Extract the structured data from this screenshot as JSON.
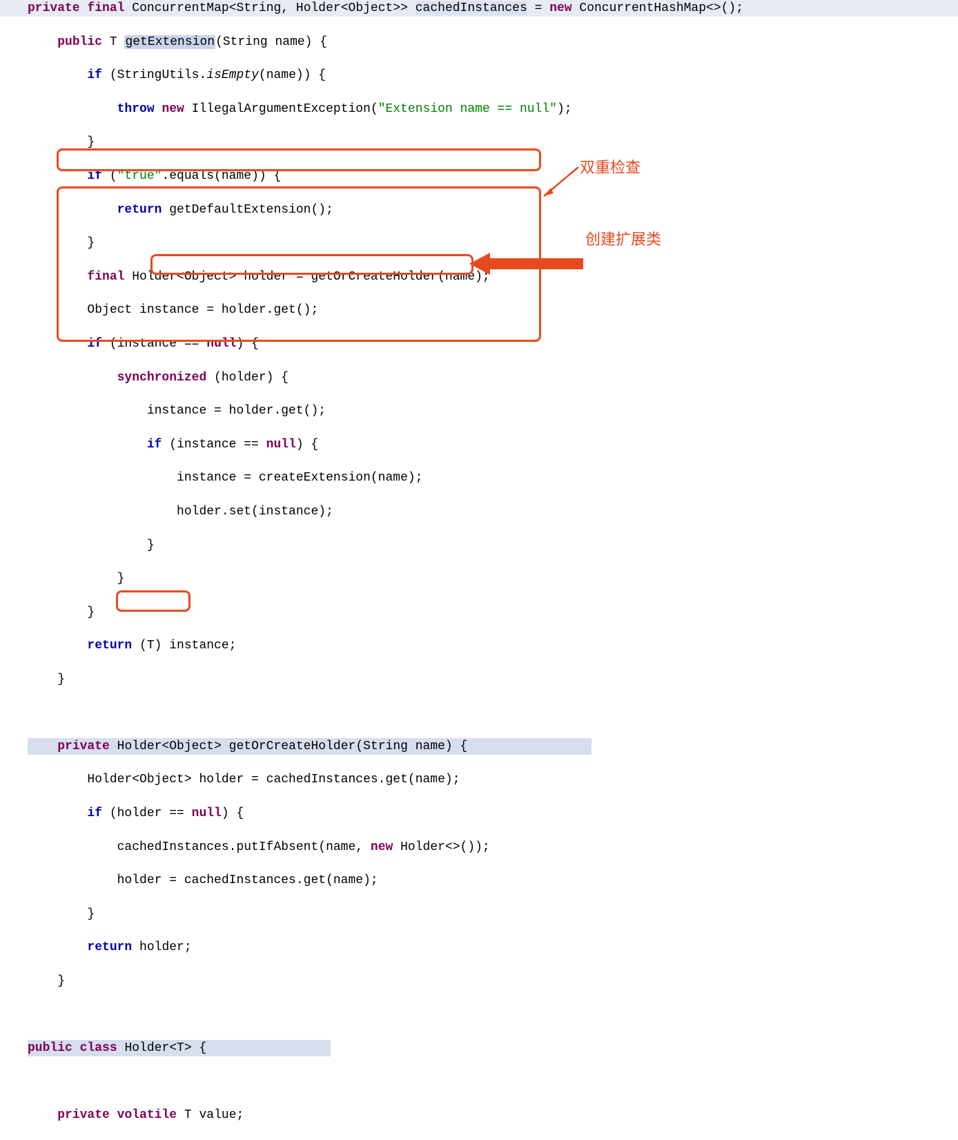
{
  "code": {
    "l1": {
      "private": "private",
      "final": "final",
      "type": "ConcurrentMap<String, Holder<Object>>",
      "var": "cachedInstances",
      "eq": " = ",
      "new": "new",
      "ctor": " ConcurrentHashMap<>();"
    },
    "l2": {
      "public": "public",
      "t": " T ",
      "method": "getExtension",
      "sig": "(String name) {"
    },
    "l3": {
      "if": "if",
      "a": " (StringUtils.",
      "isEmpty": "isEmpty",
      "b": "(name)) {"
    },
    "l4": {
      "throw": "throw",
      "sp": " ",
      "new": "new",
      "a": " IllegalArgumentException(",
      "s": "\"Extension name == null\"",
      "b": ");"
    },
    "l5": "        }",
    "l6": {
      "if": "if",
      "a": " (",
      "s": "\"true\"",
      "b": ".equals(name)) {"
    },
    "l7": {
      "return": "return",
      "a": " getDefaultExtension();"
    },
    "l8": "        }",
    "l9": {
      "final": "final",
      "a": " Holder<Object> holder = getOrCreateHolder(name);"
    },
    "l10": "        Object instance = holder.get();",
    "l11": {
      "if": "if",
      "a": " (instance == ",
      "null": "null",
      "b": ") {"
    },
    "l12": {
      "sync": "synchronized",
      "a": " (holder) {"
    },
    "l13": "                instance = holder.get();",
    "l14": {
      "if": "if",
      "a": " (instance == ",
      "null": "null",
      "b": ") {"
    },
    "l15": "                    instance = createExtension(name);",
    "l16": "                    holder.set(instance);",
    "l17": "                }",
    "l18": "            }",
    "l19": "        }",
    "l20": {
      "return": "return",
      "a": " (T) instance;"
    },
    "l21": "    }",
    "l22": "",
    "l23": {
      "private": "private",
      "a": " Holder<Object> ",
      "method": "getOrCreateHolder",
      "sig": "(String name) {"
    },
    "l24": "        Holder<Object> holder = cachedInstances.get(name);",
    "l25": {
      "if": "if",
      "a": " (holder == ",
      "null": "null",
      "b": ") {"
    },
    "l26": {
      "a": "            cachedInstances.putIfAbsent(name, ",
      "new": "new",
      "b": " Holder<>());"
    },
    "l27": "            holder = cachedInstances.get(name);",
    "l28": "        }",
    "l29": {
      "return": "return",
      "a": " holder;"
    },
    "l30": "    }",
    "l31": "",
    "l32": {
      "public": "public",
      "sp": " ",
      "class": "class",
      "a": " Holder<T> {"
    },
    "l33": "",
    "l34": {
      "private": "private",
      "sp": " ",
      "volatile": "volatile",
      "a": " T value;"
    }
  },
  "annotations": {
    "a1": "双重检查",
    "a2": "创建扩展类"
  }
}
